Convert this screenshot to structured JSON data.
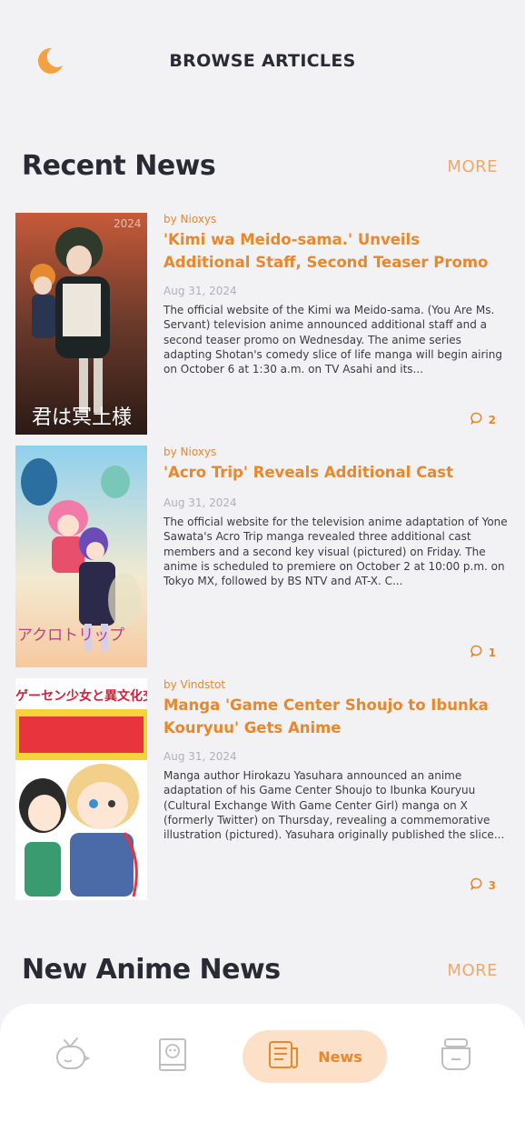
{
  "header": {
    "title": "BROWSE ARTICLES",
    "theme_icon": "moon-icon",
    "accent": "#f5a043"
  },
  "sections": [
    {
      "title": "Recent News",
      "more_label": "MORE"
    },
    {
      "title": "New Anime News",
      "more_label": "MORE"
    }
  ],
  "articles": [
    {
      "author": "by Nioxys",
      "title": "'Kimi wa Meido-sama.' Unveils Additional Staff, Second Teaser Promo",
      "date": "Aug 31, 2024",
      "excerpt": "The official website of the Kimi wa Meido-sama. (You Are Ms. Servant) television anime announced additional staff and a second teaser promo on Wednesday. The anime series adapting Shotan's comedy slice of life manga will begin airing on October 6 at 1:30 a.m. on TV Asahi and its...",
      "comments": "2",
      "thumb_text": "君は冥土様"
    },
    {
      "author": "by Nioxys",
      "title": "'Acro Trip' Reveals Additional Cast",
      "date": "Aug 31, 2024",
      "excerpt": "The official website for the television anime adaptation of Yone Sawata's Acro Trip manga revealed three additional cast members and a second key visual (pictured) on Friday. The anime is scheduled to premiere on October 2 at 10:00 p.m. on Tokyo MX, followed by BS NTV and AT-X. C...",
      "comments": "1",
      "thumb_text": "アクロトリップ"
    },
    {
      "author": "by Vindstot",
      "title": "Manga 'Game Center Shoujo to Ibunka Kouryuu' Gets Anime",
      "date": "Aug 31, 2024",
      "excerpt": "Manga author Hirokazu Yasuhara announced an anime adaptation of his Game Center Shoujo to Ibunka Kouryuu (Cultural Exchange With Game Center Girl) manga on X (formerly Twitter) on Thursday, revealing a commemorative illustration (pictured). Yasuhara originally published the slice...",
      "comments": "3",
      "thumb_text": "ゲーセン少女と異文化交流"
    }
  ],
  "bottom_nav": {
    "items": [
      {
        "icon": "tv-icon"
      },
      {
        "icon": "manga-book-icon"
      },
      {
        "icon": "news-icon",
        "label": "News",
        "active": true
      },
      {
        "icon": "bowl-icon"
      }
    ]
  }
}
